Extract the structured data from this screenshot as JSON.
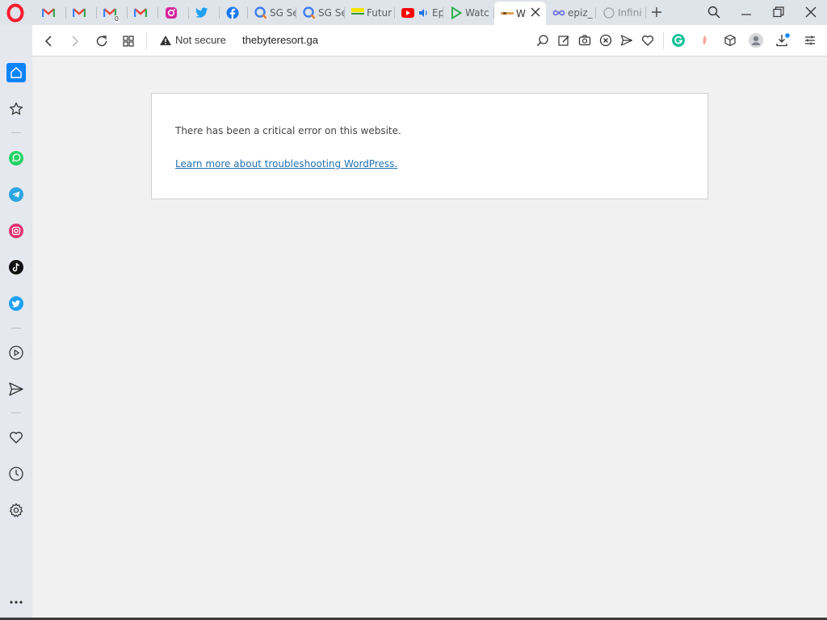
{
  "tabs": [
    {
      "title": "",
      "icon": "gmail-icon"
    },
    {
      "title": "",
      "icon": "gmail-icon"
    },
    {
      "title": "",
      "icon": "gmail-icon",
      "badge": "0"
    },
    {
      "title": "",
      "icon": "gmail-icon"
    },
    {
      "title": "",
      "icon": "instagram-icon"
    },
    {
      "title": "",
      "icon": "twitter-icon"
    },
    {
      "title": "",
      "icon": "facebook-icon"
    },
    {
      "title": "SG Se",
      "icon": "sg-search-icon"
    },
    {
      "title": "SG Se",
      "icon": "sg-search-icon"
    },
    {
      "title": "Futur",
      "icon": "yellow-flag-icon"
    },
    {
      "title": "Ep",
      "icon": "youtube-icon"
    },
    {
      "title": "Watc",
      "icon": "play-icon"
    },
    {
      "title": "W",
      "icon": "site-favicon",
      "active": true
    },
    {
      "title": "epiz_",
      "icon": "infinity-icon"
    },
    {
      "title": "Infini",
      "icon": "loading-icon"
    }
  ],
  "address_bar": {
    "security_text": "Not secure",
    "url": "thebyteresort.ga"
  },
  "page": {
    "error_message": "There has been a critical error on this website.",
    "help_link": "Learn more about troubleshooting WordPress."
  },
  "colors": {
    "accent": "#0a84ff",
    "link": "#2271b1",
    "opera_red": "#ff1b2d"
  }
}
